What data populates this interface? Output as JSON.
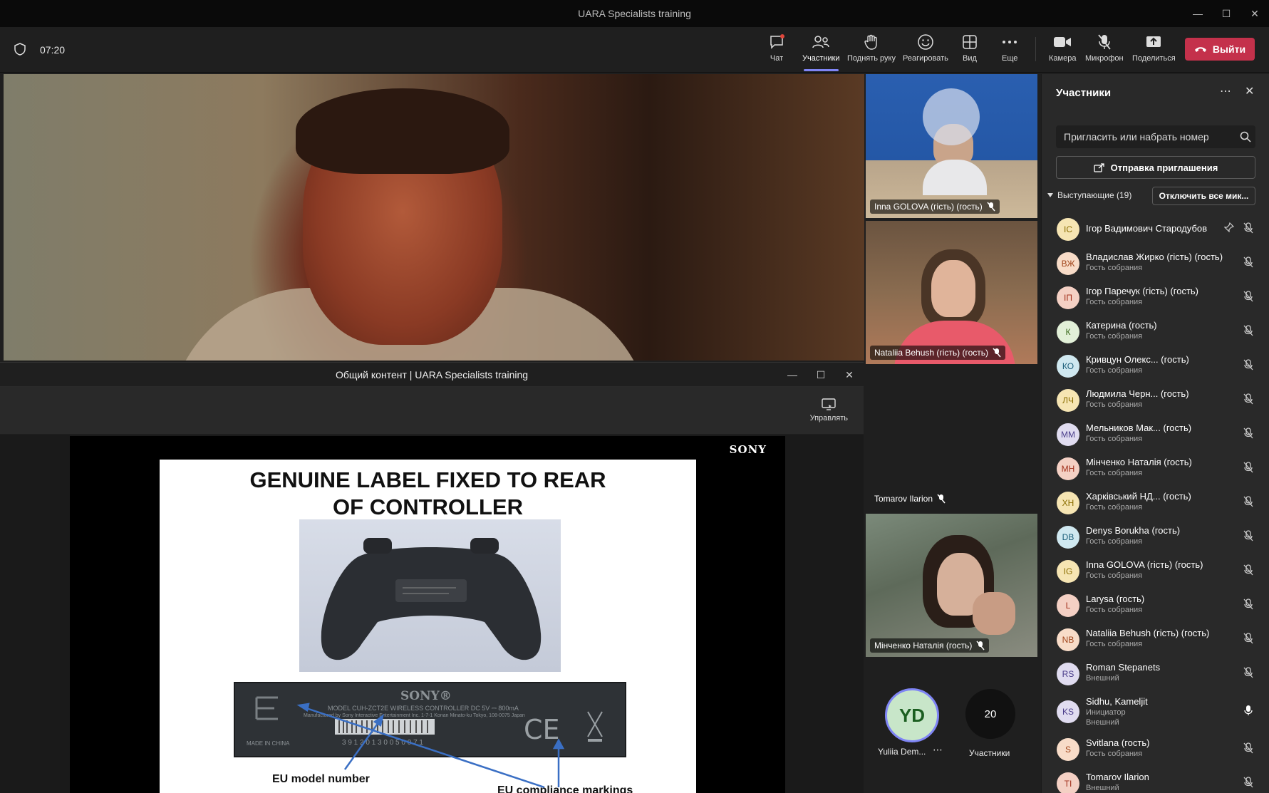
{
  "window": {
    "title": "UARA Specialists training"
  },
  "toolbar": {
    "timer": "07:20",
    "chat": "Чат",
    "participants": "Участники",
    "raise_hand": "Поднять руку",
    "react": "Реагировать",
    "view": "Вид",
    "more": "Еще",
    "camera": "Камера",
    "mic": "Микрофон",
    "share": "Поделиться",
    "leave": "Выйти"
  },
  "shared": {
    "window_title": "Общий контент | UARA Specialists training",
    "manage": "Управлять",
    "slide": {
      "brand": "SONY",
      "title_line1": "GENUINE LABEL FIXED TO REAR",
      "title_line2": "OF CONTROLLER",
      "caption_model": "EU model number",
      "caption_markings": "EU compliance markings",
      "label_brand": "SONY®",
      "label_model": "MODEL CUH-ZCT2E  WIRELESS CONTROLLER  DC 5V ⎓ 800mA",
      "label_maker": "Manufactured by Sony Interactive Entertainment Inc.  1-7-1 Konan Minato-ku Tokyo, 108-0075 Japan",
      "label_barcode": "3 9 1 2 0 1 3 0 0 5 0 0 7 1",
      "label_origin": "MADE IN CHINA"
    }
  },
  "tiles": [
    {
      "name": "Inna GOLOVA (гість) (гость)"
    },
    {
      "name": "Nataliia Behush (гість) (гость)"
    },
    {
      "name": "Tomarov Ilarion"
    },
    {
      "name": "Мінченко Наталія (гость)"
    }
  ],
  "bottom": {
    "yd_initials": "YD",
    "yd_name": "Yuliia Dem...",
    "count": "20",
    "count_label": "Участники"
  },
  "panel": {
    "title": "Участники",
    "search_placeholder": "Пригласить или набрать номер",
    "invite": "Отправка приглашения",
    "section": "Выступающие (19)",
    "mute_all": "Отключить все мик...",
    "people": [
      {
        "initials": "IC",
        "name": "Ігор Вадимович Стародубов",
        "role": "",
        "color": "#f6e5b3",
        "tc": "#8a6d00"
      },
      {
        "initials": "ВЖ",
        "name": "Владислав Жирко (гість) (гость)",
        "role": "Гость собрания",
        "color": "#f8dcc8",
        "tc": "#a1461c"
      },
      {
        "initials": "ІП",
        "name": "Ігор Паречук (гість) (гость)",
        "role": "Гость собрания",
        "color": "#f4d0c4",
        "tc": "#a1301c"
      },
      {
        "initials": "К",
        "name": "Катерина (гость)",
        "role": "Гость собрания",
        "color": "#e2f0d8",
        "tc": "#3b6b1f"
      },
      {
        "initials": "КО",
        "name": "Кривцун Олекс...  (гость)",
        "role": "Гость собрания",
        "color": "#cfe8f0",
        "tc": "#1d5f7a"
      },
      {
        "initials": "ЛЧ",
        "name": "Людмила Черн...  (гость)",
        "role": "Гость собрания",
        "color": "#f6e5b3",
        "tc": "#8a6d00"
      },
      {
        "initials": "ММ",
        "name": "Мельников Мак... (гость)",
        "role": "Гость собрания",
        "color": "#e0dcf0",
        "tc": "#4a3d8a"
      },
      {
        "initials": "МН",
        "name": "Мінченко Наталія (гость)",
        "role": "Гость собрания",
        "color": "#f4d0c4",
        "tc": "#a1301c"
      },
      {
        "initials": "ХН",
        "name": "Харківський НД... (гость)",
        "role": "Гость собрания",
        "color": "#f6e5b3",
        "tc": "#8a6d00"
      },
      {
        "initials": "DB",
        "name": "Denys Borukha (гость)",
        "role": "Гость собрания",
        "color": "#cfe8f0",
        "tc": "#1d5f7a"
      },
      {
        "initials": "IG",
        "name": "Inna GOLOVA (гість) (гость)",
        "role": "Гость собрания",
        "color": "#f6e5b3",
        "tc": "#8a6d00"
      },
      {
        "initials": "L",
        "name": "Larysa (гость)",
        "role": "Гость собрания",
        "color": "#f4d0c4",
        "tc": "#a1301c"
      },
      {
        "initials": "NB",
        "name": "Nataliia Behush (гість) (гость)",
        "role": "Гость собрания",
        "color": "#f8dcc8",
        "tc": "#a1461c"
      },
      {
        "initials": "RS",
        "name": "Roman Stepanets",
        "role": "Внешний",
        "color": "#e0dcf0",
        "tc": "#4a3d8a"
      },
      {
        "initials": "KS",
        "name": "Sidhu, Kameljit",
        "role": "Инициатор",
        "role2": "Внешний",
        "color": "#e0dcf0",
        "tc": "#4a3d8a"
      },
      {
        "initials": "S",
        "name": "Svitlana (гость)",
        "role": "Гость собрания",
        "color": "#f8dcc8",
        "tc": "#a1461c"
      },
      {
        "initials": "TI",
        "name": "Tomarov Ilarion",
        "role": "Внешний",
        "color": "#f4d0c4",
        "tc": "#a1301c"
      }
    ]
  }
}
